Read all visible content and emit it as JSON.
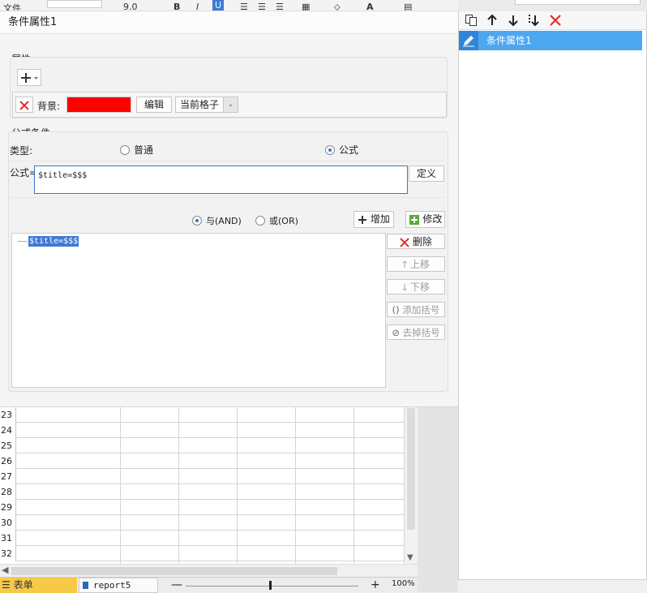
{
  "background_toolbar": {
    "file_label": "文件",
    "font_size": "9.0",
    "bold": "B",
    "italic": "I",
    "underline": "U",
    "text_a": "A"
  },
  "dialog": {
    "title": "条件属性1",
    "attributes": {
      "label": "属性:",
      "background_label": "背景:",
      "background_color": "#ff0000",
      "edit_button": "编辑",
      "scope_value": "当前格子"
    },
    "formula_condition": {
      "group_label": "公式条件",
      "type_label": "类型:",
      "type_options": [
        "普通",
        "公式"
      ],
      "type_selected": "公式",
      "formula_label": "公式=",
      "formula_value": "$title=$$$",
      "define_button": "定义",
      "logic_options": [
        "与(AND)",
        "或(OR)"
      ],
      "logic_selected": "与(AND)",
      "add_button": "增加",
      "modify_button": "修改",
      "tree_item": "$title=$$$",
      "side_buttons": {
        "delete": "删除",
        "move_up": "上移",
        "move_down": "下移",
        "add_bracket": "添加括号",
        "remove_bracket": "去掉括号"
      }
    }
  },
  "right_panel": {
    "conditions": [
      "条件属性1"
    ],
    "selected_condition": "条件属性1"
  },
  "spreadsheet": {
    "row_numbers": [
      "23",
      "24",
      "25",
      "26",
      "27",
      "28",
      "29",
      "30",
      "31",
      "32"
    ]
  },
  "statusbar": {
    "sheet_tab": "表单",
    "report_tab": "report5",
    "zoom_minus": "—",
    "zoom_plus": "+",
    "zoom_level": "100%"
  },
  "colors": {
    "accent": "#4da6f0",
    "selection": "#3d7ad6",
    "delete_red": "#e0302a"
  }
}
